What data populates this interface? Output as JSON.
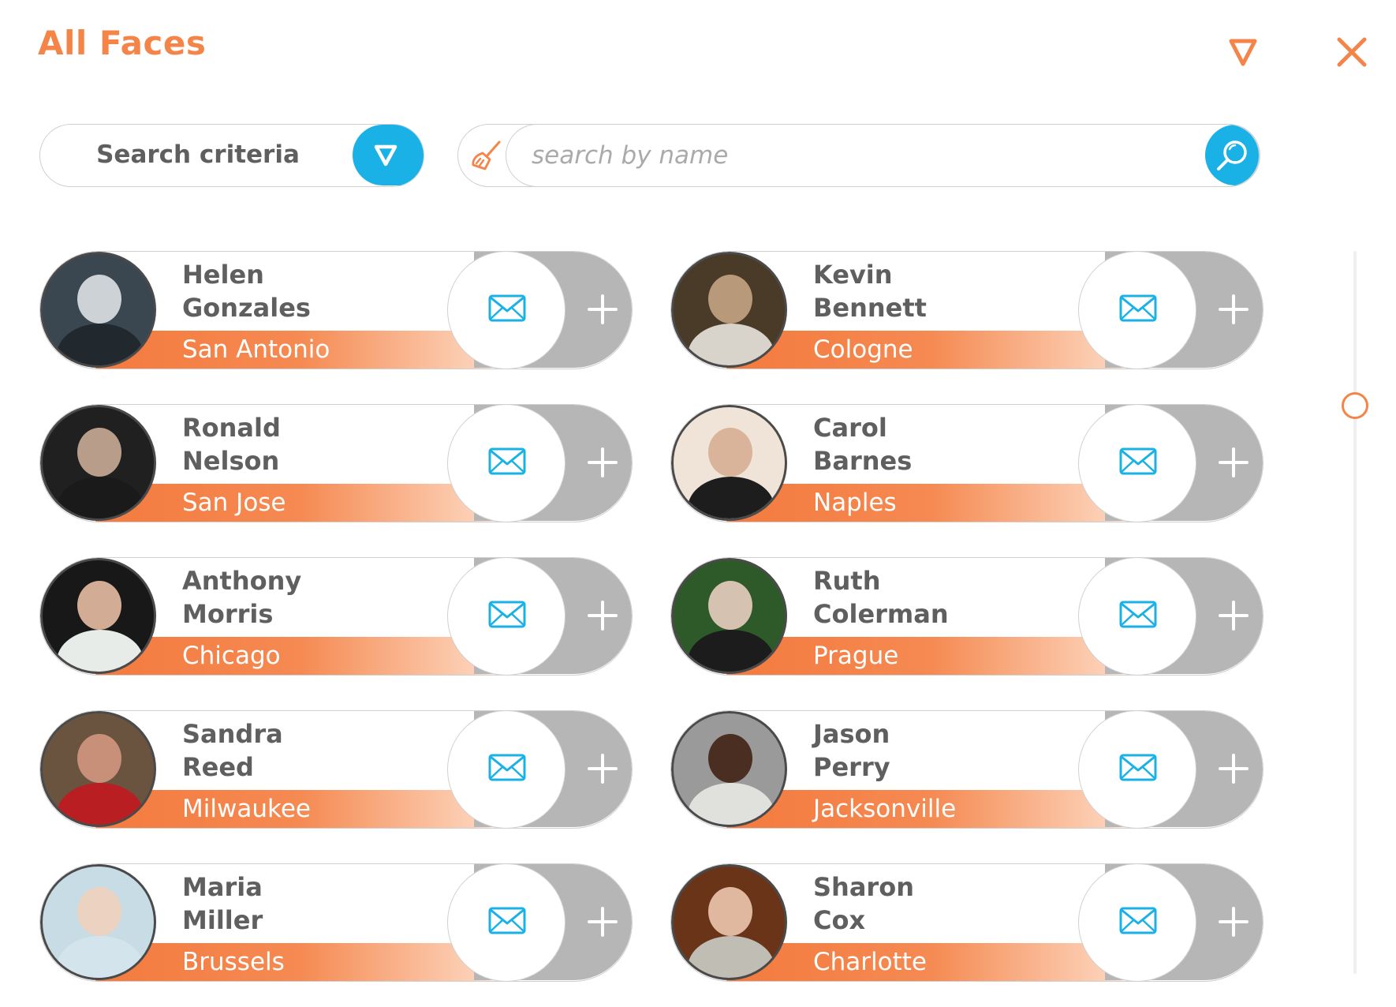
{
  "header": {
    "title": "All Faces",
    "filter_icon": "filter-triangle-icon",
    "close_icon": "close-icon"
  },
  "search": {
    "criteria_label": "Search criteria",
    "criteria_icon": "filter-triangle-icon",
    "clear_icon": "broom-icon",
    "placeholder": "search by name",
    "value": "",
    "search_icon": "search-icon"
  },
  "colors": {
    "accent": "#f58449",
    "blue": "#1ab2e6",
    "text": "#5f5f5f",
    "gray_action": "#b6b6b6"
  },
  "people": [
    {
      "first": "Helen",
      "last": "Gonzales",
      "city": "San Antonio"
    },
    {
      "first": "Kevin",
      "last": "Bennett",
      "city": "Cologne"
    },
    {
      "first": "Ronald",
      "last": "Nelson",
      "city": "San Jose"
    },
    {
      "first": "Carol",
      "last": "Barnes",
      "city": "Naples"
    },
    {
      "first": "Anthony",
      "last": "Morris",
      "city": "Chicago"
    },
    {
      "first": "Ruth",
      "last": "Colerman",
      "city": "Prague"
    },
    {
      "first": "Sandra",
      "last": "Reed",
      "city": "Milwaukee"
    },
    {
      "first": "Jason",
      "last": "Perry",
      "city": "Jacksonville"
    },
    {
      "first": "Maria",
      "last": "Miller",
      "city": "Brussels"
    },
    {
      "first": "Sharon",
      "last": "Cox",
      "city": "Charlotte"
    }
  ],
  "card_actions": {
    "message_icon": "envelope-icon",
    "add_icon": "plus-icon"
  }
}
